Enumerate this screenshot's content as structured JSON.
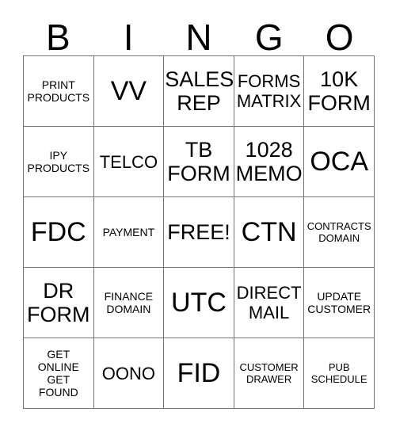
{
  "card": {
    "title": "BINGO",
    "header_letters": [
      "B",
      "I",
      "N",
      "G",
      "O"
    ],
    "free_space_label": "FREE!",
    "border_color": "#737373",
    "text_color": "#000000",
    "background_color": "#ffffff",
    "rows": [
      [
        {
          "text": "PRINT\nPRODUCTS",
          "size": "sm"
        },
        {
          "text": "VV",
          "size": "xl"
        },
        {
          "text": "SALES\nREP",
          "size": "lg"
        },
        {
          "text": "FORMS\nMATRIX",
          "size": "md"
        },
        {
          "text": "10K\nFORM",
          "size": "lg"
        }
      ],
      [
        {
          "text": "IPY\nPRODUCTS",
          "size": "sm"
        },
        {
          "text": "TELCO",
          "size": "md"
        },
        {
          "text": "TB\nFORM",
          "size": "lg"
        },
        {
          "text": "1028\nMEMO",
          "size": "lg"
        },
        {
          "text": "OCA",
          "size": "xl"
        }
      ],
      [
        {
          "text": "FDC",
          "size": "xl"
        },
        {
          "text": "PAYMENT",
          "size": "xxs"
        },
        {
          "text": "FREE!",
          "size": "lg"
        },
        {
          "text": "CTN",
          "size": "xl"
        },
        {
          "text": "CONTRACTS\nDOMAIN",
          "size": "xs"
        }
      ],
      [
        {
          "text": "DR\nFORM",
          "size": "lg"
        },
        {
          "text": "FINANCE\nDOMAIN",
          "size": "sm"
        },
        {
          "text": "UTC",
          "size": "xl"
        },
        {
          "text": "DIRECT\nMAIL",
          "size": "md"
        },
        {
          "text": "UPDATE\nCUSTOMER",
          "size": "sm"
        }
      ],
      [
        {
          "text": "GET\nONLINE\nGET\nFOUND",
          "size": "sm"
        },
        {
          "text": "OONO",
          "size": "md"
        },
        {
          "text": "FID",
          "size": "xl"
        },
        {
          "text": "CUSTOMER\nDRAWER",
          "size": "xs"
        },
        {
          "text": "PUB\nSCHEDULE",
          "size": "xs"
        }
      ]
    ]
  }
}
